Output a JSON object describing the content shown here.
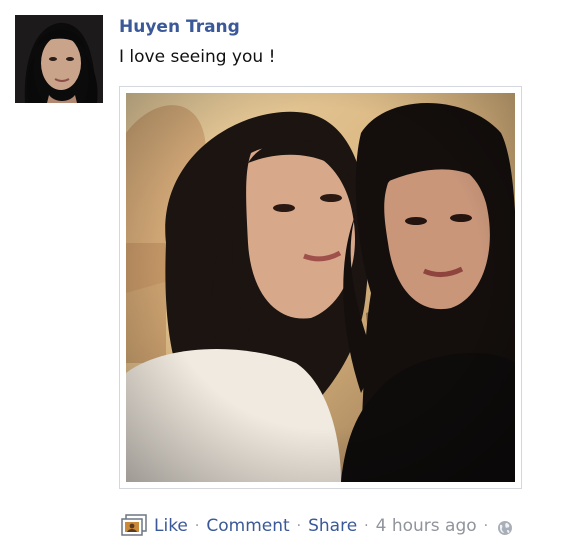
{
  "post": {
    "author_name": "Huyen Trang",
    "status_text": "I love seeing you !",
    "photo_alt": "Photo",
    "actions": {
      "like_label": "Like",
      "comment_label": "Comment",
      "share_label": "Share",
      "separator": "·",
      "timestamp": "4 hours ago"
    },
    "icons": {
      "post_type_icon": "photo-icon",
      "privacy_icon": "globe-icon"
    },
    "colors": {
      "link": "#3b5998",
      "meta": "#90949c",
      "text": "#111111"
    }
  }
}
